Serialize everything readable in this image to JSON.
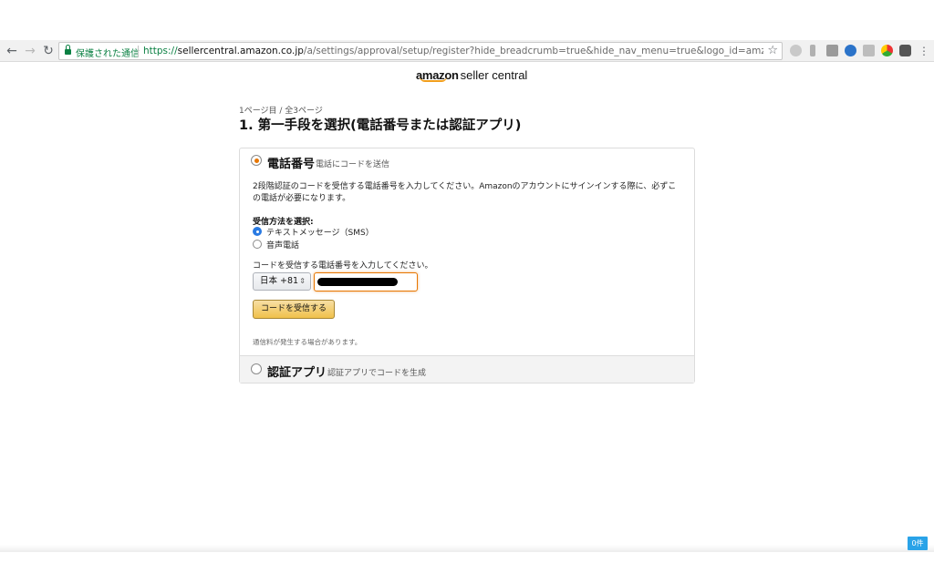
{
  "browser": {
    "secure_label": "保護された通信",
    "url_scheme": "https://",
    "url_host": "sellercentral.amazon.co.jp",
    "url_path": "/a/settings/approval/setup/register?hide_breadcrumb=true&hide_nav_menu=true&logo_id=amzn_sc&return_to=%..."
  },
  "logo": {
    "brand": "amazon",
    "product": "seller central"
  },
  "page": {
    "step": "1ページ目 / 全3ページ",
    "title": "1. 第一手段を選択(電話番号または認証アプリ)"
  },
  "phone_section": {
    "heading": "電話番号",
    "subheading": "電話にコードを送信",
    "description": "2段階認証のコードを受信する電話番号を入力してください。Amazonのアカウントにサインインする際に、必ずこの電話が必要になります。",
    "method_label": "受信方法を選択:",
    "methods": [
      {
        "label": "テキストメッセージ（SMS）",
        "selected": true
      },
      {
        "label": "音声電話",
        "selected": false
      }
    ],
    "phone_prompt": "コードを受信する電話番号を入力してください。",
    "country_code": "日本 +81",
    "send_button": "コードを受信する",
    "note": "通信料が発生する場合があります。"
  },
  "app_section": {
    "heading": "認証アプリ",
    "subheading": "認証アプリでコードを生成"
  },
  "badge": "0件",
  "colors": {
    "accent_orange": "#e77600",
    "button_yellow": "#f0c14b",
    "radio_blue": "#2a7ae2",
    "secure_green": "#0b8043",
    "badge_blue": "#2aa3e8"
  }
}
